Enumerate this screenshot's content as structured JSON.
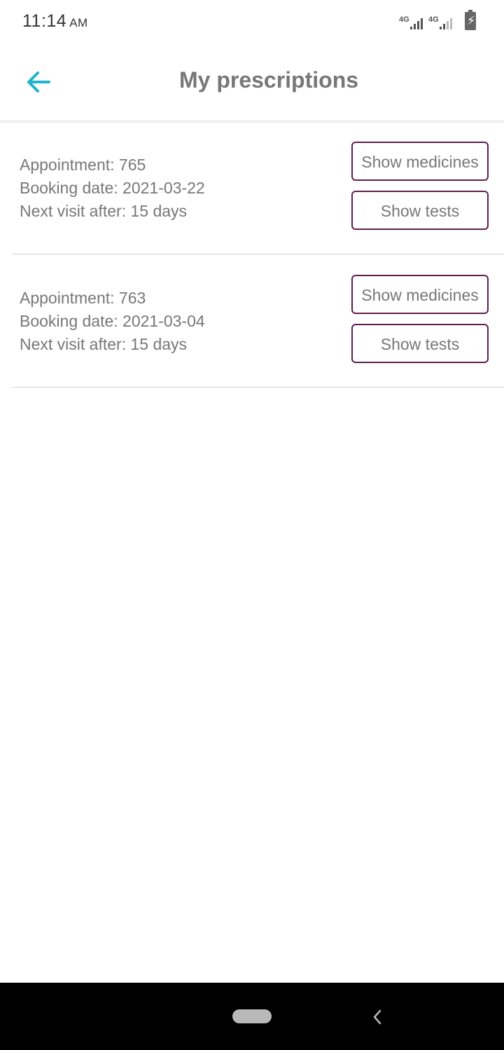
{
  "status_bar": {
    "time": "11:14",
    "ampm": "AM",
    "network_1": "4G",
    "network_2": "4G",
    "icons": [
      "signal-icon",
      "signal-icon",
      "battery-charging-icon"
    ]
  },
  "app_bar": {
    "title": "My prescriptions",
    "back_icon": "arrow-left-icon",
    "accent_color": "#1fb3cc"
  },
  "prescriptions": [
    {
      "appointment": "Appointment: 765",
      "booking_date": "Booking date: 2021-03-22",
      "next_visit": "Next visit after: 15 days",
      "medicines_label": "Show medicines",
      "tests_label": "Show tests"
    },
    {
      "appointment": "Appointment: 763",
      "booking_date": "Booking date: 2021-03-04",
      "next_visit": "Next visit after: 15 days",
      "medicines_label": "Show medicines",
      "tests_label": "Show tests"
    }
  ],
  "colors": {
    "button_border": "#5e1f4e",
    "text_gray": "#777777",
    "nav_background": "#000000"
  },
  "nav_bar": {
    "icons": [
      "home-pill-icon",
      "back-chevron-icon"
    ]
  }
}
